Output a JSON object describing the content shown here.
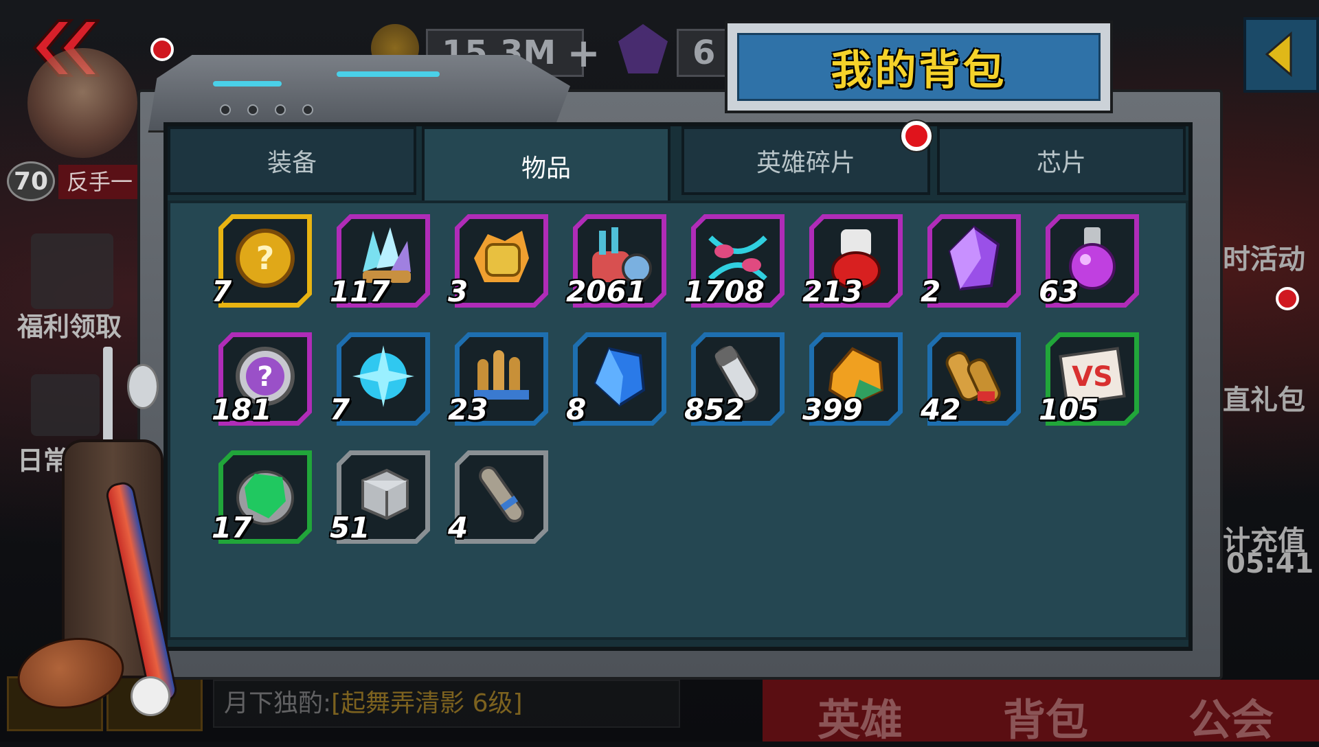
{
  "header": {
    "title": "我的背包",
    "gold_amount": "15.3M",
    "gold_add": "+",
    "gem_amount": "6"
  },
  "player": {
    "level": "70",
    "name": "反手一"
  },
  "left_menu": [
    "福利领取",
    "日常任"
  ],
  "right_menu": [
    "时活动",
    "直礼包",
    "计充值",
    "05:41"
  ],
  "tabs": [
    {
      "label": "装备",
      "active": false
    },
    {
      "label": "物品",
      "active": true
    },
    {
      "label": "英雄碎片",
      "active": false,
      "badge": true
    },
    {
      "label": "芯片",
      "active": false
    }
  ],
  "items": [
    {
      "icon": "mystery-coin-icon",
      "count": "7",
      "rarity": "gold"
    },
    {
      "icon": "crystal-cluster-icon",
      "count": "117",
      "rarity": "purple"
    },
    {
      "icon": "golden-fist-icon",
      "count": "3",
      "rarity": "purple"
    },
    {
      "icon": "coral-device-icon",
      "count": "2061",
      "rarity": "purple"
    },
    {
      "icon": "dna-helix-icon",
      "count": "1708",
      "rarity": "purple"
    },
    {
      "icon": "red-potion-vial-icon",
      "count": "213",
      "rarity": "purple"
    },
    {
      "icon": "purple-gem-icon",
      "count": "2",
      "rarity": "purple"
    },
    {
      "icon": "purple-flask-icon",
      "count": "63",
      "rarity": "purple"
    },
    {
      "icon": "purple-mystery-chip-icon",
      "count": "181",
      "rarity": "purple"
    },
    {
      "icon": "blue-snowflake-icon",
      "count": "7",
      "rarity": "blue"
    },
    {
      "icon": "bullets-icon",
      "count": "23",
      "rarity": "blue"
    },
    {
      "icon": "blue-crystal-icon",
      "count": "8",
      "rarity": "blue"
    },
    {
      "icon": "test-tube-icon",
      "count": "852",
      "rarity": "blue"
    },
    {
      "icon": "amber-stone-icon",
      "count": "399",
      "rarity": "blue"
    },
    {
      "icon": "scroll-bundle-icon",
      "count": "42",
      "rarity": "blue"
    },
    {
      "icon": "vs-card-icon",
      "count": "105",
      "rarity": "green"
    },
    {
      "icon": "green-ore-icon",
      "count": "17",
      "rarity": "green"
    },
    {
      "icon": "iron-cube-icon",
      "count": "51",
      "rarity": "gray"
    },
    {
      "icon": "rolled-scroll-icon",
      "count": "4",
      "rarity": "gray"
    }
  ],
  "rarity_colors": {
    "gold": "#e8b412",
    "purple": "#b02cb8",
    "blue": "#1e6fb0",
    "green": "#21a63a",
    "gray": "#8a9094"
  },
  "bottom_nav": [
    "英雄",
    "背包",
    "公会"
  ],
  "chat": {
    "name": "月下独酌:",
    "tag": "[起舞弄清影 6级]"
  }
}
